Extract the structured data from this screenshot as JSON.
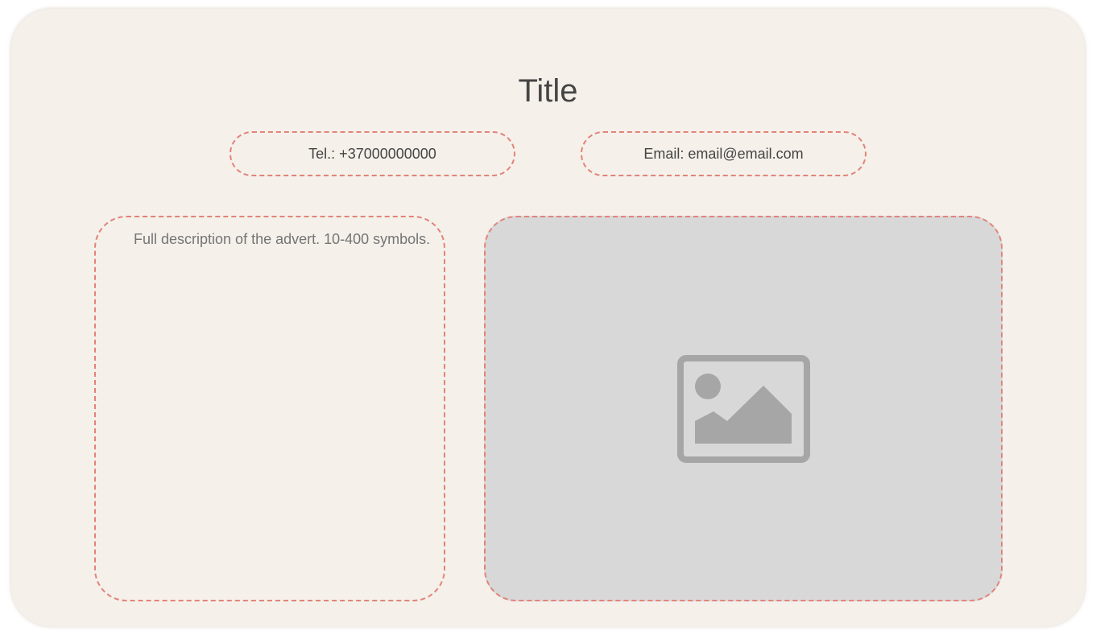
{
  "advert": {
    "title": "Title",
    "phone": "Tel.: +37000000000",
    "email": "Email: email@email.com",
    "description_placeholder": "Full description of the advert. 10-400 symbols."
  },
  "icons": {
    "image_placeholder": "image-placeholder-icon"
  },
  "colors": {
    "card_background": "#f5f0ea",
    "dashed_border": "#e2837a",
    "image_background": "#d8d8d8",
    "icon_gray": "#a6a6a6",
    "text": "#454545"
  }
}
